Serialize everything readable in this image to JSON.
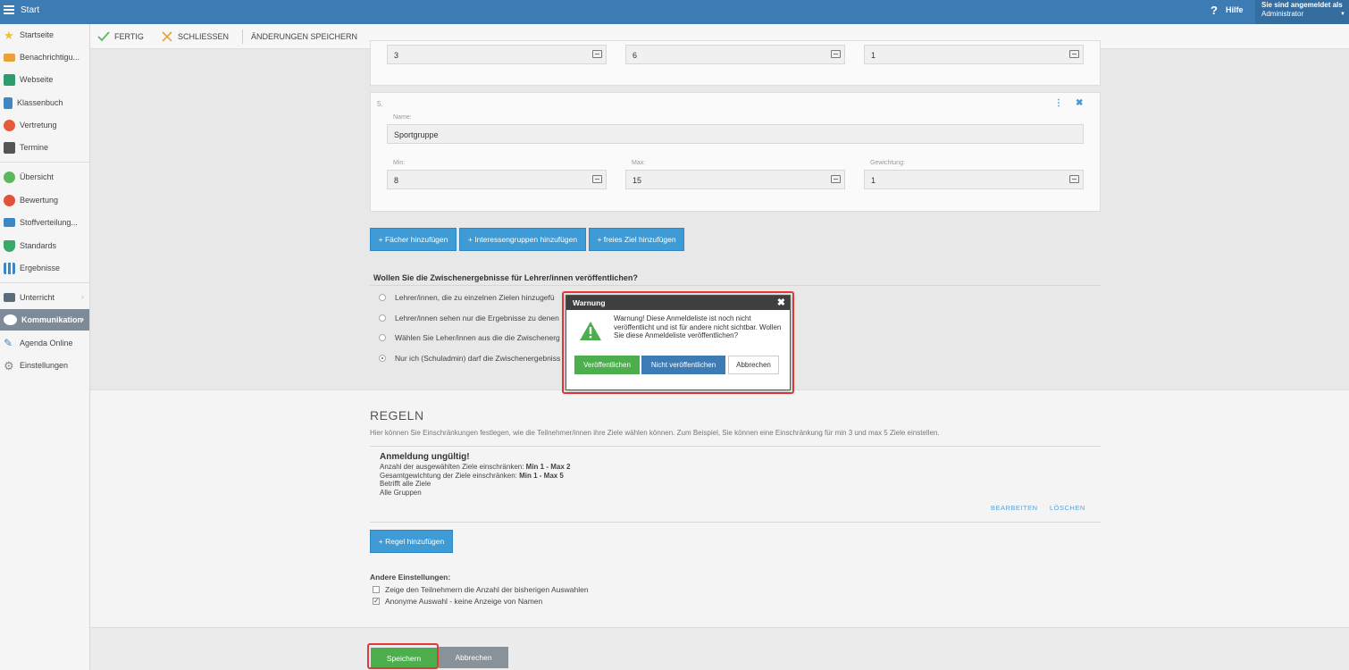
{
  "topbar": {
    "title": "Start",
    "help": "Hilfe",
    "user_line1": "Sie sind angemeldet als",
    "user_line2": "Administrator"
  },
  "sidebar": {
    "items": [
      {
        "label": "Startseite",
        "color": "#f2c12e"
      },
      {
        "label": "Benachrichtigu...",
        "color": "#e8a23a"
      },
      {
        "label": "Webseite",
        "color": "#2f9c6e"
      },
      {
        "label": "Klassenbuch",
        "color": "#3f86c4"
      },
      {
        "label": "Vertretung",
        "color": "#e45b3a"
      },
      {
        "label": "Termine",
        "color": "#555555"
      },
      {
        "label": "Übersicht",
        "color": "#5cb85c"
      },
      {
        "label": "Bewertung",
        "color": "#e0533b"
      },
      {
        "label": "Stoffverteilung...",
        "color": "#3f86c4"
      },
      {
        "label": "Standards",
        "color": "#3aa86b"
      },
      {
        "label": "Ergebnisse",
        "color": "#3f86c4"
      },
      {
        "label": "Unterricht",
        "color": "#5a6b7c"
      },
      {
        "label": "Kommunikation",
        "color": "#ffffff"
      },
      {
        "label": "Agenda Online",
        "color": "#3f86c4"
      },
      {
        "label": "Einstellungen",
        "color": "#888888"
      }
    ]
  },
  "toolbar": {
    "done": "FERTIG",
    "close": "SCHLIESSEN",
    "save_changes": "ÄNDERUNGEN SPEICHERN"
  },
  "group_prev": {
    "min": "3",
    "max": "6",
    "weight": "1"
  },
  "group5": {
    "number": "5.",
    "name_label": "Name:",
    "name": "Sportgruppe",
    "min_label": "Min:",
    "min": "8",
    "max_label": "Max:",
    "max": "15",
    "weight_label": "Gewichtung:",
    "weight": "1"
  },
  "add_buttons": {
    "subjects": "+ Fächer hinzufügen",
    "interest_groups": "+ Interessengruppen hinzufügen",
    "free_goal": "+ freies Ziel hinzufügen"
  },
  "publish": {
    "question": "Wollen Sie die Zwischenergebnisse für Lehrer/innen veröffentlichen?",
    "options": [
      "Lehrer/innen, die zu einzelnen Zielen hinzugefü",
      "Lehrer/innen sehen nur die Ergebnisse zu denen",
      "Wählen Sie Leher/innen aus die die Zwischenerg",
      "Nur ich (Schuladmin) darf die Zwischenergebniss"
    ]
  },
  "rules": {
    "title": "REGELN",
    "description": "Hier können Sie Einschränkungen festlegen, wie die Teilnehmer/innen ihre Ziele wählen können. Zum Beispiel, Sie können eine Einschränkung für min 3 und max 5 Ziele einstellen.",
    "rule_title": "Anmeldung ungültig!",
    "line1_text": "Anzahl der ausgewählten Ziele einschränken: ",
    "line1_bold": "Min 1 - Max 2",
    "line2_text": "Gesamtgewichtung der Ziele einschränken: ",
    "line2_bold": "Min 1 - Max 5",
    "line3": "Betrifft alle Ziele",
    "line4": "Alle Gruppen",
    "edit": "BEARBEITEN",
    "delete": "LÖSCHEN",
    "add_rule": "+ Regel hinzufügen"
  },
  "other_settings": {
    "title": "Andere Einstellungen:",
    "opt1": "Zeige den Teilnehmern die Anzahl der bisherigen Auswahlen",
    "opt2": "Anonyme Auswahl - keine Anzeige von Namen"
  },
  "footer": {
    "save": "Speichern",
    "cancel": "Abbrechen"
  },
  "dialog": {
    "title": "Warnung",
    "message": "Warnung! Diese Anmeldeliste ist noch nicht veröffentlicht und ist für andere nicht sichtbar. Wollen Sie diese Anmeldeliste veröffentlichen?",
    "publish": "Veröffentlichen",
    "not_publish": "Nicht veröffentlichen",
    "cancel": "Abbrechen"
  },
  "colors": {
    "accent": "#3e9bd6",
    "topbar": "#3d7bb4",
    "green": "#4cae4c",
    "highlight": "#e03a3a"
  }
}
